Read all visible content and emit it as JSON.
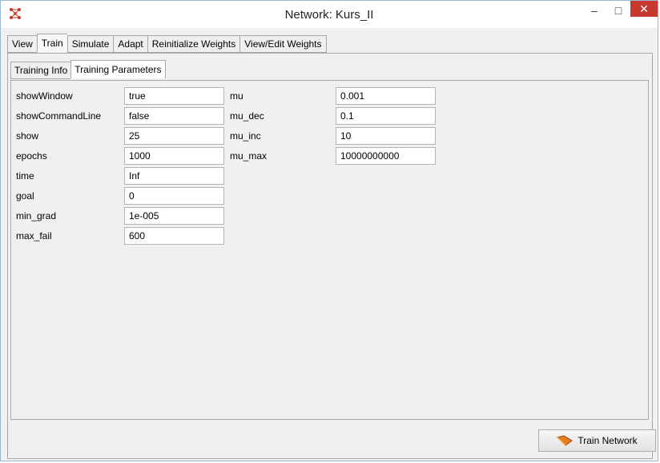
{
  "window": {
    "title": "Network: Kurs_II"
  },
  "title_controls": {
    "minimize": "–",
    "maximize": "□",
    "close": "✕"
  },
  "tabs": [
    {
      "label": "View"
    },
    {
      "label": "Train"
    },
    {
      "label": "Simulate"
    },
    {
      "label": "Adapt"
    },
    {
      "label": "Reinitialize Weights"
    },
    {
      "label": "View/Edit Weights"
    }
  ],
  "active_tab": "Train",
  "subtabs": [
    {
      "label": "Training Info"
    },
    {
      "label": "Training Parameters"
    }
  ],
  "active_subtab": "Training Parameters",
  "params_left": [
    {
      "label": "showWindow",
      "value": "true"
    },
    {
      "label": "showCommandLine",
      "value": "false"
    },
    {
      "label": "show",
      "value": "25"
    },
    {
      "label": "epochs",
      "value": "1000"
    },
    {
      "label": "time",
      "value": "Inf"
    },
    {
      "label": "goal",
      "value": "0"
    },
    {
      "label": "min_grad",
      "value": "1e-005"
    },
    {
      "label": "max_fail",
      "value": "600"
    }
  ],
  "params_right": [
    {
      "label": "mu",
      "value": "0.001"
    },
    {
      "label": "mu_dec",
      "value": "0.1"
    },
    {
      "label": "mu_inc",
      "value": "10"
    },
    {
      "label": "mu_max",
      "value": "10000000000"
    }
  ],
  "train_button": {
    "label": "Train Network",
    "icon": "train-network-icon"
  },
  "colors": {
    "close_button": "#c7392f",
    "window_border": "#9bb8d8",
    "panel_bg": "#f0f0f0"
  }
}
